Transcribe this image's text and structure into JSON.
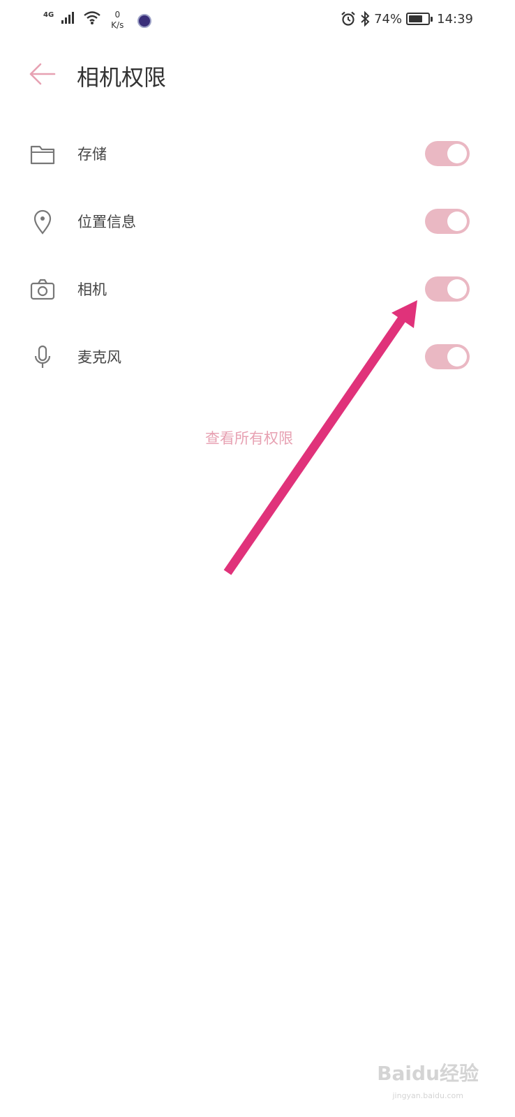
{
  "status_bar": {
    "network_type": "4G",
    "speed_value": "0",
    "speed_unit": "K/s",
    "battery": "74%",
    "battery_level": 0.74,
    "time": "14:39"
  },
  "header": {
    "title": "相机权限"
  },
  "permissions": [
    {
      "label": "存储",
      "icon": "folder-icon",
      "enabled": true
    },
    {
      "label": "位置信息",
      "icon": "location-pin-icon",
      "enabled": true
    },
    {
      "label": "相机",
      "icon": "camera-icon",
      "enabled": true
    },
    {
      "label": "麦克风",
      "icon": "microphone-icon",
      "enabled": true
    }
  ],
  "view_all_label": "查看所有权限",
  "watermark": {
    "brand": "Baidu经验",
    "url": "jingyan.baidu.com"
  },
  "colors": {
    "accent": "#e7a1b2",
    "toggle_track": "#eab8c3",
    "annotation_arrow": "#e0327a"
  }
}
